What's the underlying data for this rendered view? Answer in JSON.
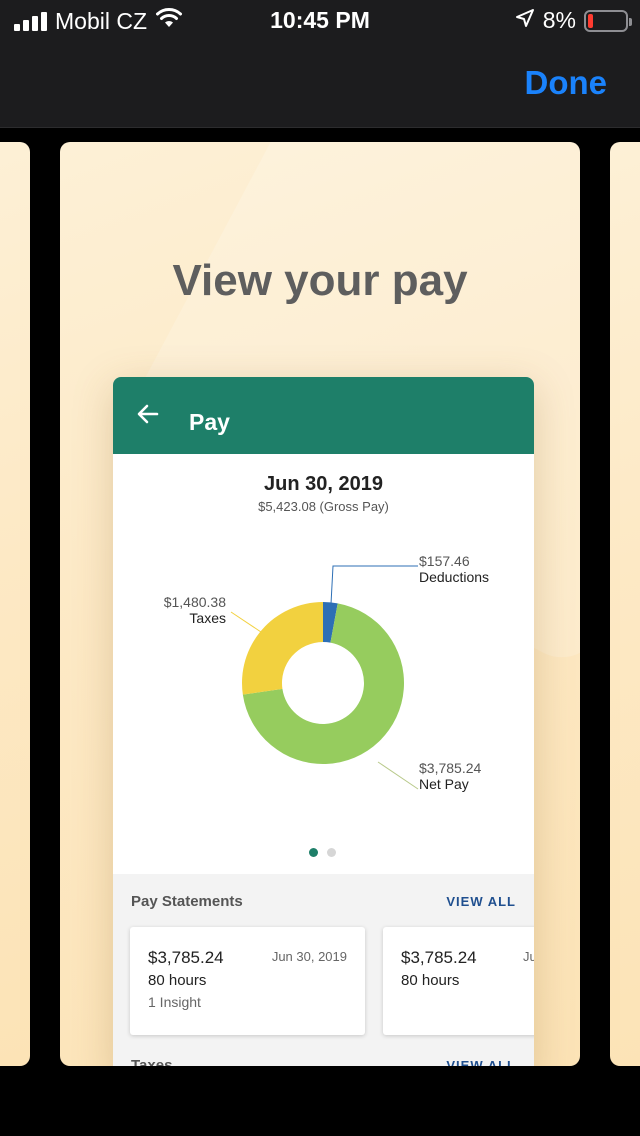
{
  "status_bar": {
    "carrier": "Mobil CZ",
    "time": "10:45 PM",
    "battery": "8%",
    "battery_level": 0.08,
    "icons": [
      "signal-icon",
      "wifi-icon",
      "location-icon",
      "battery-icon"
    ]
  },
  "nav": {
    "done_label": "Done"
  },
  "slide": {
    "title": "View your pay"
  },
  "pay_screen": {
    "header_title": "Pay",
    "date": "Jun 30, 2019",
    "gross": "$5,423.08 (Gross Pay)",
    "chart_labels": {
      "deductions_amount": "$157.46",
      "deductions_label": "Deductions",
      "taxes_amount": "$1,480.38",
      "taxes_label": "Taxes",
      "net_amount": "$3,785.24",
      "net_label": "Net Pay"
    },
    "pager": {
      "count": 2,
      "active": 0
    },
    "statements_title": "Pay Statements",
    "view_all": "VIEW ALL",
    "statements": [
      {
        "amount": "$3,785.24",
        "hours": "80 hours",
        "insight": "1 Insight",
        "date": "Jun 30, 2019"
      },
      {
        "amount": "$3,785.24",
        "hours": "80 hours",
        "date": "Ju"
      }
    ],
    "taxes_title": "Taxes",
    "taxes_view_all": "VIEW ALL"
  },
  "chart_data": {
    "type": "pie",
    "categories": [
      "Deductions",
      "Net Pay",
      "Taxes"
    ],
    "values": [
      157.46,
      3785.24,
      1480.38
    ],
    "colors": [
      "#2d6fb5",
      "#96cc5e",
      "#f2d13f"
    ],
    "title": "",
    "donut": true
  },
  "colors": {
    "header_green": "#1e7f69",
    "done_blue": "#1a82fb",
    "view_all_blue": "#1f4f8f"
  }
}
